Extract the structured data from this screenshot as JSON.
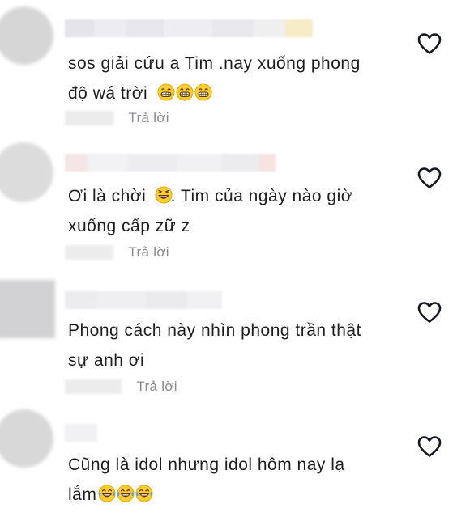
{
  "comments": [
    {
      "text_line1": "sos giải cứu a Tim .nay xuống phong",
      "text_line2": "độ wá trời",
      "emoji_line2": [
        "grin-emoji",
        "grin-emoji",
        "grin-emoji"
      ],
      "reply_label": "Trả lời"
    },
    {
      "text_line1a": "Ơi là chời",
      "text_line1b": ". Tim của ngày nào giờ",
      "emoji_line1": [
        "laugh-emoji"
      ],
      "text_line2": "xuống cấp zữ z",
      "reply_label": "Trả lời"
    },
    {
      "text_line1": "Phong cách này nhìn phong trần thật",
      "text_line2": "sự anh ơi",
      "reply_label": "Trả lời"
    },
    {
      "text_line1": "Cũng là idol nhưng idol hôm nay lạ",
      "text_line2": "lắm",
      "emoji_line2": [
        "tears-joy-emoji",
        "tears-joy-emoji",
        "tears-joy-emoji"
      ]
    }
  ],
  "icons": {
    "like": "heart-outline-icon"
  },
  "colors": {
    "text": "#1e1e1e",
    "reply": "#8a8b91",
    "heart_stroke": "#161823"
  }
}
